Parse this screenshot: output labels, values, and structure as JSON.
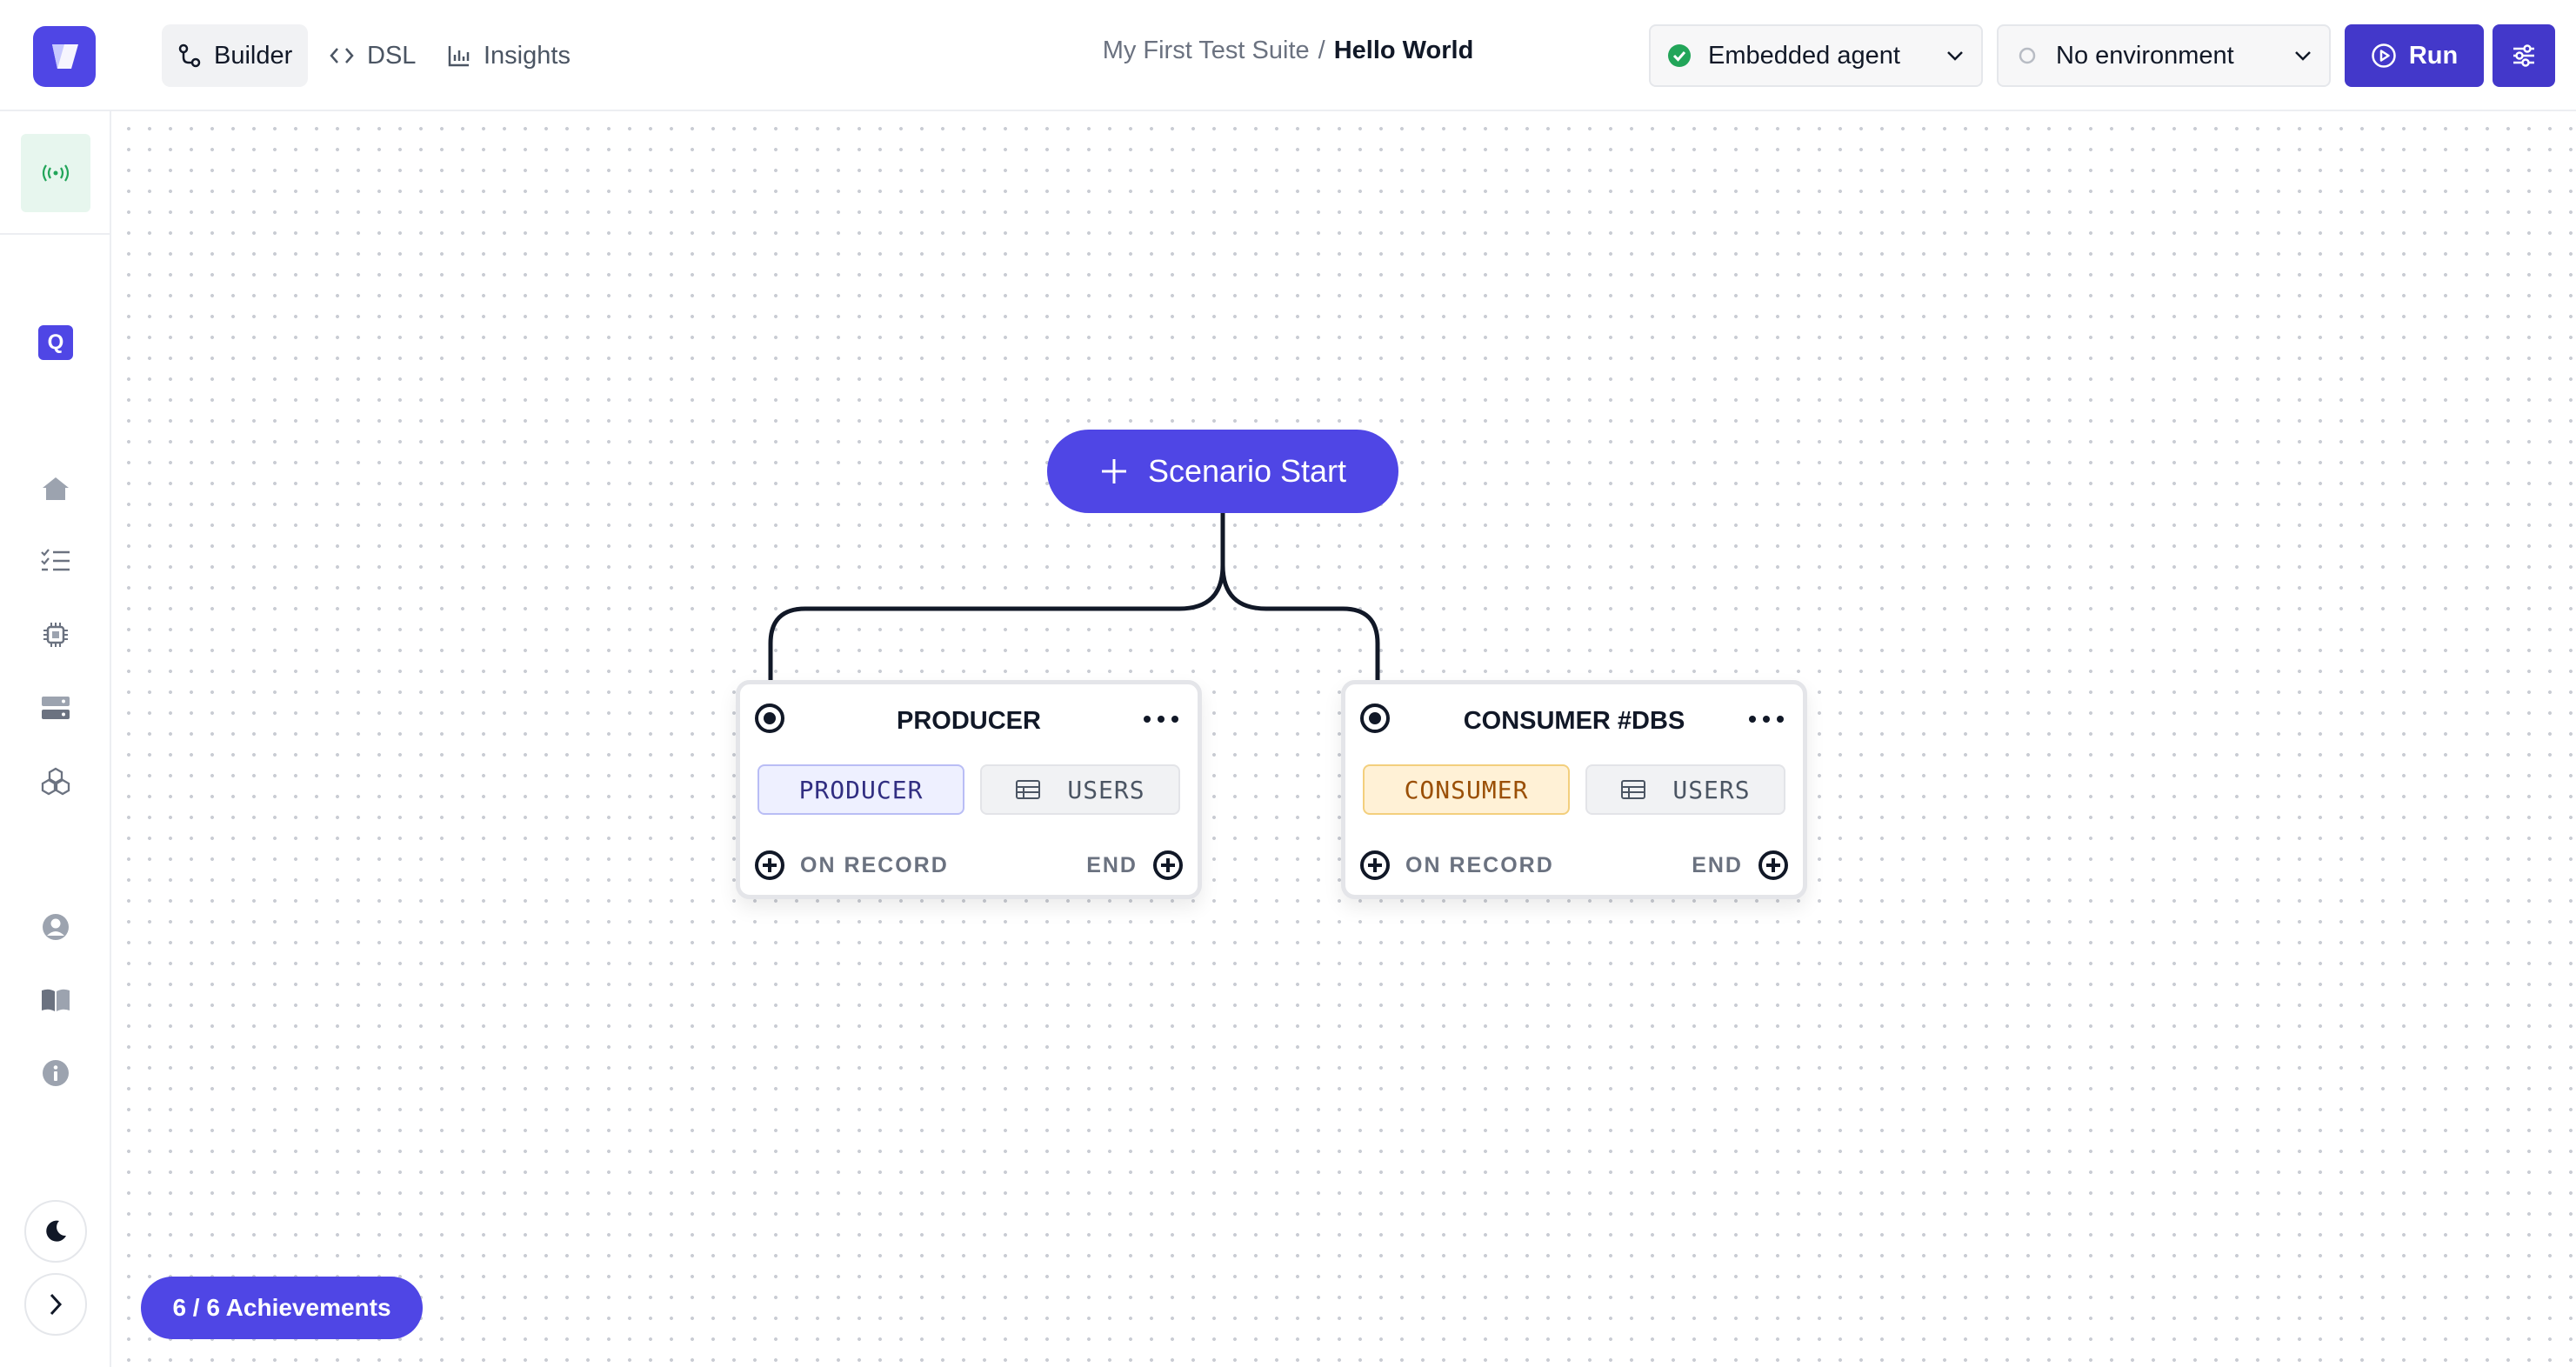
{
  "header": {
    "tabs": [
      {
        "label": "Builder",
        "icon": "route-icon",
        "active": true
      },
      {
        "label": "DSL",
        "icon": "code-icon",
        "active": false
      },
      {
        "label": "Insights",
        "icon": "bar-chart-icon",
        "active": false
      }
    ],
    "breadcrumb": {
      "suite": "My First Test Suite",
      "separator": "/",
      "scenario": "Hello World"
    },
    "agent_select": {
      "label": "Embedded agent",
      "status_color": "#22a559"
    },
    "environment_select": {
      "label": "No environment"
    },
    "run_label": "Run"
  },
  "sidebar": {
    "top_item": "live-broadcast-icon",
    "workspace_badge": "Q",
    "nav_icons": [
      "home-icon",
      "checklist-icon",
      "chip-icon",
      "server-icon",
      "cubes-icon"
    ],
    "bottom_icons": [
      "user-icon",
      "book-icon",
      "info-icon"
    ]
  },
  "canvas": {
    "start_node": {
      "label": "Scenario Start"
    },
    "nodes": [
      {
        "title": "PRODUCER",
        "type_tag": "PRODUCER",
        "source_tag": "USERS",
        "left_action": "ON RECORD",
        "right_action": "END"
      },
      {
        "title": "CONSUMER #DBS",
        "type_tag": "CONSUMER",
        "source_tag": "USERS",
        "left_action": "ON RECORD",
        "right_action": "END"
      }
    ]
  },
  "achievements": {
    "label": "6 / 6 Achievements"
  },
  "colors": {
    "accent": "#4f46e5",
    "run": "#4338ca",
    "producer_tag": "#eef0ff",
    "consumer_tag": "#fff1d6"
  }
}
